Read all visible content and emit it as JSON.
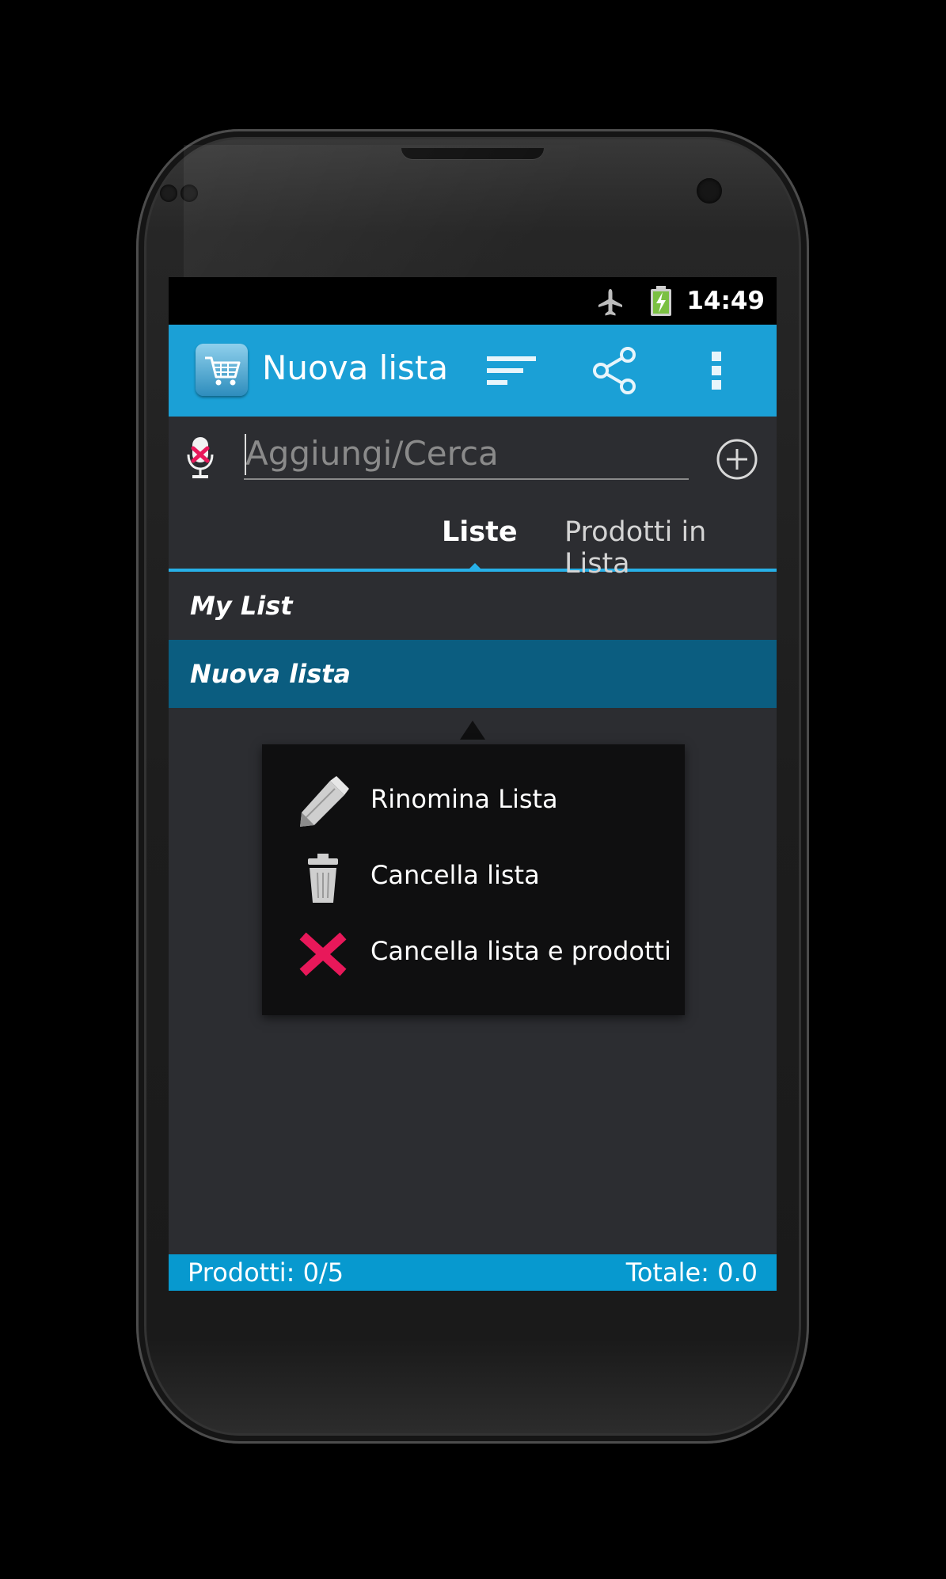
{
  "status_bar": {
    "time": "14:49",
    "icons": [
      "airplane-mode-icon",
      "battery-charging-icon"
    ]
  },
  "action_bar": {
    "app_icon": "shopping-cart-icon",
    "title": "Nuova lista",
    "actions": [
      "sort-icon",
      "share-icon",
      "overflow-menu-icon"
    ]
  },
  "search": {
    "placeholder": "Aggiungi/Cerca",
    "value": ""
  },
  "tabs": [
    {
      "label": "Liste",
      "active": true
    },
    {
      "label": "Prodotti in Lista",
      "active": false
    }
  ],
  "lists": [
    {
      "name": "My List",
      "selected": false
    },
    {
      "name": "Nuova lista",
      "selected": true
    }
  ],
  "context_menu": {
    "items": [
      {
        "label": "Rinomina Lista",
        "icon": "pencil-icon"
      },
      {
        "label": "Cancella lista",
        "icon": "trash-icon"
      },
      {
        "label": "Cancella lista e prodotti",
        "icon": "delete-x-icon"
      }
    ]
  },
  "footer": {
    "products": "Prodotti: 0/5",
    "total": "Totale: 0.0"
  },
  "colors": {
    "accent": "#1ba0d6",
    "selected_row": "#0b5d80",
    "danger": "#e8185a",
    "background": "#2c2d31"
  }
}
